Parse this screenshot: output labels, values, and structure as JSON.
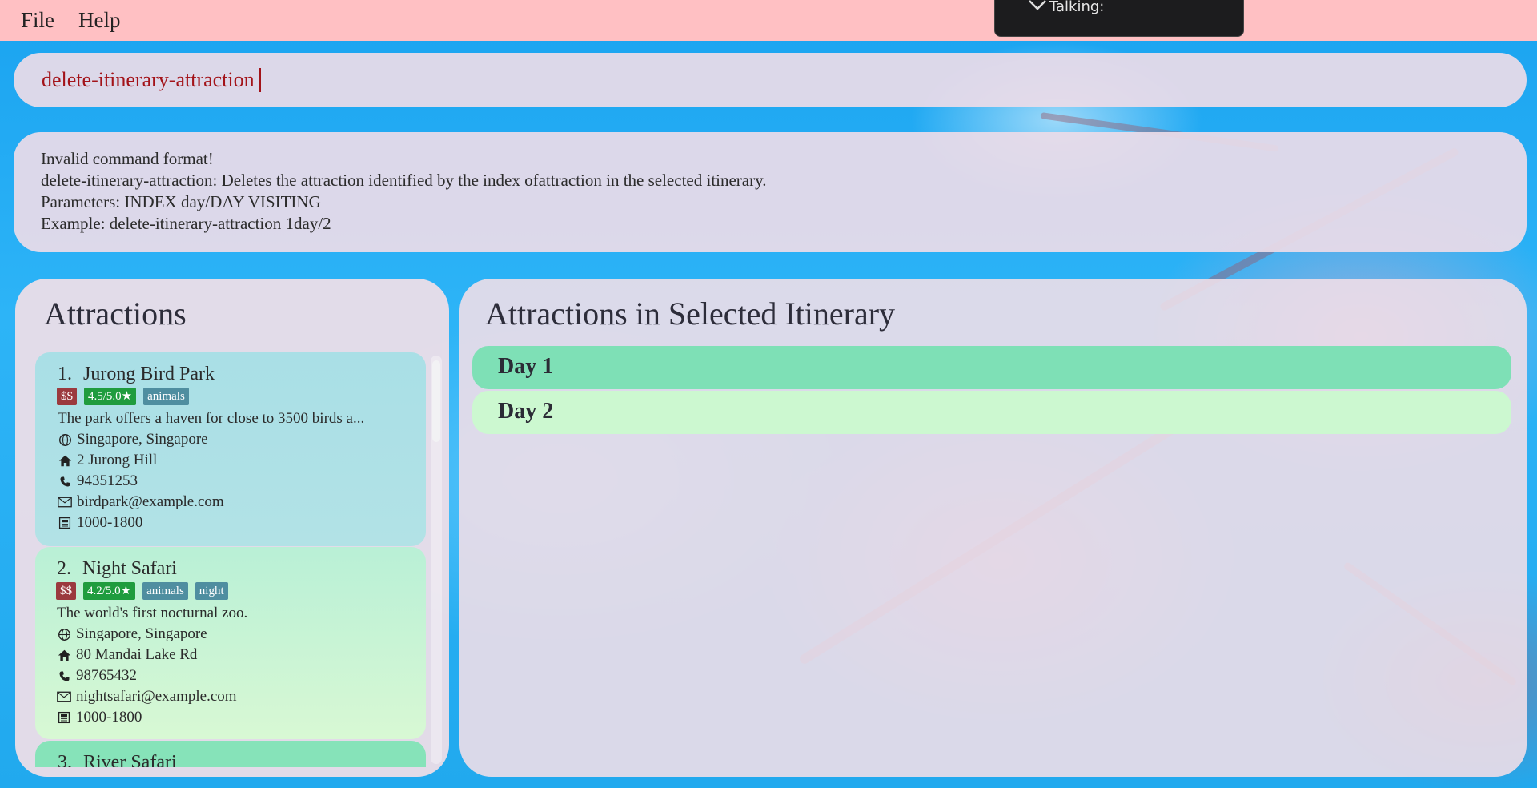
{
  "menu": {
    "file": "File",
    "help": "Help"
  },
  "overlay": {
    "talking": "Talking:"
  },
  "command": {
    "text": "delete-itinerary-attraction"
  },
  "result": {
    "lines": [
      "Invalid command format!",
      "delete-itinerary-attraction: Deletes the attraction identified by the index ofattraction in the selected itinerary.",
      "Parameters: INDEX day/DAY VISITING",
      "Example: delete-itinerary-attraction 1day/2"
    ]
  },
  "attractions": {
    "title": "Attractions",
    "items": [
      {
        "index": "1.",
        "name": "Jurong Bird Park",
        "price": "$$",
        "rating": "4.5/5.0★",
        "tags": [
          "animals"
        ],
        "description": "The park offers a haven for close to 3500 birds a...",
        "location": "Singapore, Singapore",
        "address": "2 Jurong Hill",
        "phone": "94351253",
        "email": "birdpark@example.com",
        "hours": "1000-1800"
      },
      {
        "index": "2.",
        "name": "Night Safari",
        "price": "$$",
        "rating": "4.2/5.0★",
        "tags": [
          "animals",
          "night"
        ],
        "description": "The world's first nocturnal zoo.",
        "location": "Singapore, Singapore",
        "address": "80 Mandai Lake Rd",
        "phone": "98765432",
        "email": "nightsafari@example.com",
        "hours": "1000-1800"
      },
      {
        "index": "3.",
        "name": "River Safari"
      }
    ]
  },
  "itinerary": {
    "title": "Attractions in Selected Itinerary",
    "days": [
      "Day 1",
      "Day 2"
    ]
  },
  "colors": {
    "menubar": "#ffc0c3",
    "command_text": "#a31319",
    "day1": "#7ee0b6",
    "day2": "#ccf8d0",
    "tag_price": "#9b3a3e",
    "tag_rating": "#1f9c3e",
    "tag_category": "#4f8ea0"
  },
  "icons": [
    "globe-icon",
    "home-icon",
    "phone-icon",
    "email-icon",
    "hours-icon",
    "chevron-down-icon"
  ]
}
